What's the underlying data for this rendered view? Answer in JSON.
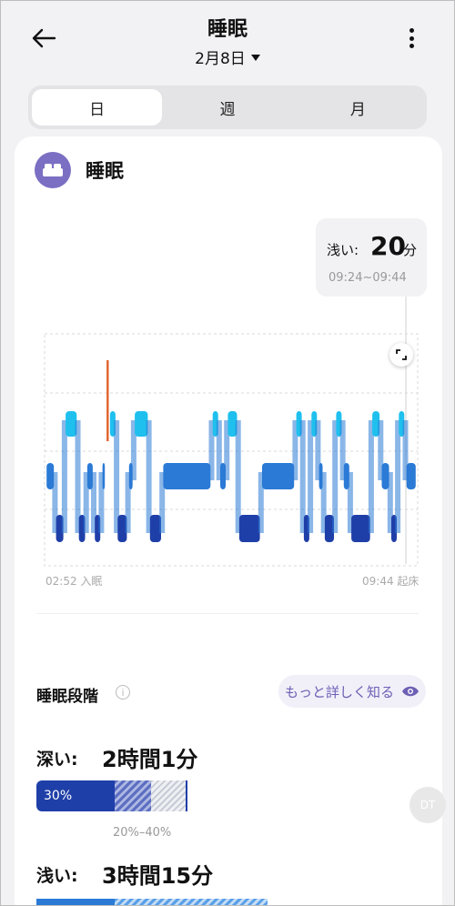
{
  "header": {
    "title": "睡眠",
    "date": "2月8日"
  },
  "tabs": [
    {
      "label": "日",
      "active": true
    },
    {
      "label": "週",
      "active": false
    },
    {
      "label": "月",
      "active": false
    }
  ],
  "card": {
    "title": "睡眠"
  },
  "tooltip": {
    "label": "浅い:",
    "value": "20",
    "unit": "分",
    "range": "09:24~09:44"
  },
  "chart_data": {
    "type": "sleep-hypnogram",
    "x_start": "02:52",
    "x_start_label": "入眠",
    "x_end": "09:44",
    "x_end_label": "起床",
    "stage_colors": {
      "awake": "#e2612b",
      "rem": "#1fc0ee",
      "light": "#2a7ad6",
      "deep": "#1f3fa8"
    },
    "segments": [
      {
        "stage": "light",
        "duration": 0.025
      },
      {
        "stage": "deep",
        "duration": 0.025
      },
      {
        "stage": "rem",
        "duration": 0.035
      },
      {
        "stage": "deep",
        "duration": 0.022
      },
      {
        "stage": "light",
        "duration": 0.02
      },
      {
        "stage": "deep",
        "duration": 0.02
      },
      {
        "stage": "light",
        "duration": 0.012
      },
      {
        "stage": "awake",
        "duration": 0.008
      },
      {
        "stage": "rem",
        "duration": 0.02
      },
      {
        "stage": "deep",
        "duration": 0.03
      },
      {
        "stage": "light",
        "duration": 0.015
      },
      {
        "stage": "rem",
        "duration": 0.04
      },
      {
        "stage": "deep",
        "duration": 0.035
      },
      {
        "stage": "light",
        "duration": 0.13
      },
      {
        "stage": "rem",
        "duration": 0.02
      },
      {
        "stage": "light",
        "duration": 0.02
      },
      {
        "stage": "rem",
        "duration": 0.03
      },
      {
        "stage": "deep",
        "duration": 0.06
      },
      {
        "stage": "light",
        "duration": 0.09
      },
      {
        "stage": "rem",
        "duration": 0.02
      },
      {
        "stage": "deep",
        "duration": 0.02
      },
      {
        "stage": "rem",
        "duration": 0.02
      },
      {
        "stage": "light",
        "duration": 0.015
      },
      {
        "stage": "deep",
        "duration": 0.03
      },
      {
        "stage": "rem",
        "duration": 0.02
      },
      {
        "stage": "light",
        "duration": 0.02
      },
      {
        "stage": "deep",
        "duration": 0.055
      },
      {
        "stage": "rem",
        "duration": 0.025
      },
      {
        "stage": "light",
        "duration": 0.025
      },
      {
        "stage": "deep",
        "duration": 0.02
      },
      {
        "stage": "rem",
        "duration": 0.02
      },
      {
        "stage": "light",
        "duration": 0.03
      }
    ]
  },
  "stages": {
    "title": "睡眠段階",
    "learn_more": "もっと詳しく知る",
    "deep": {
      "label": "深い:",
      "value": "2時間1分",
      "percent": "30%",
      "range": "20%–40%"
    },
    "light": {
      "label": "浅い:",
      "value": "3時間15分"
    }
  },
  "float_button": {
    "text": "DT"
  }
}
